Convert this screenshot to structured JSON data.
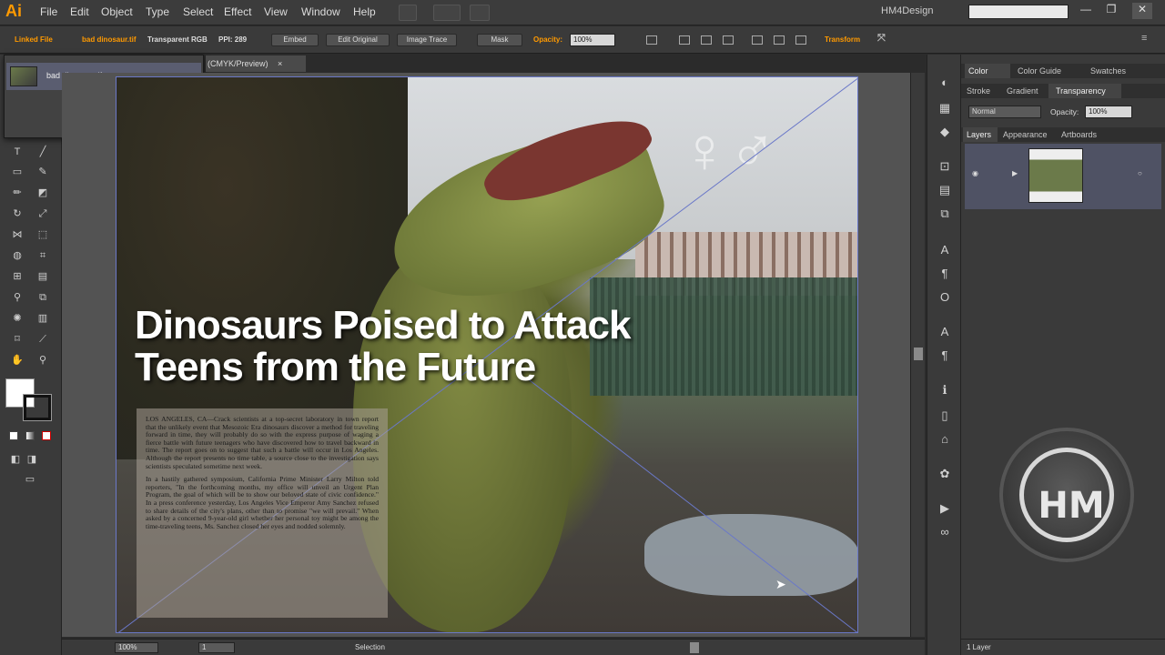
{
  "app": {
    "logo": "Ai",
    "workspace": "HM4Design",
    "search_placeholder": ""
  },
  "menu": [
    "File",
    "Edit",
    "Object",
    "Type",
    "Select",
    "Effect",
    "View",
    "Window",
    "Help"
  ],
  "controlbar": {
    "linked_file": "Linked File",
    "file_name": "bad dinosaur.tif",
    "color_mode": "Transparent RGB",
    "ppi": "PPI: 289",
    "embed": "Embed",
    "edit_original": "Edit Original",
    "image_trace": "Image Trace",
    "mask": "Mask",
    "opacity_label": "Opacity:",
    "opacity_value": "100%",
    "transform": "Transform"
  },
  "links_panel": {
    "item": "bad dinosaur.tif"
  },
  "document": {
    "tab_label": "(CMYK/Preview)"
  },
  "artboard": {
    "headline_line1": "Dinosaurs Poised to Attack",
    "headline_line2": "Teens from the Future",
    "paragraph1": "LOS ANGELES, CA—Crack scientists at a top-secret laboratory in town report that the unlikely event that Mesozoic Era dinosaurs discover a method for traveling forward in time, they will probably do so with the express purpose of waging a fierce battle with future teenagers who have discovered how to travel backward in time. The report goes on to suggest that such a battle will occur in Los Angeles. Although the report presents no time table, a source close to the investigation says scientists speculated sometime next week.",
    "paragraph2": "In a hastily gathered symposium, California Prime Minister Larry Milton told reporters, \"In the forthcoming months, my office will unveil an Urgent Plan Program, the goal of which will be to show our beloved state of civic confidence.\" In a press conference yesterday, Los Angeles Vice Emperor Amy Sanchez refused to share details of the city's plans, other than to promise \"we will prevail.\" When asked by a concerned 9-year-old girl whether her personal toy might be among the time-traveling teens, Ms. Sanchez closed her eyes and nodded solemnly."
  },
  "statusbar": {
    "zoom": "100%",
    "artboard_num": "1",
    "tool": "Selection"
  },
  "right_panels": {
    "tabs_row1": [
      "Color",
      "Color Guide",
      "Swatches"
    ],
    "tabs_row2": [
      "Stroke",
      "Gradient",
      "Transparency"
    ],
    "blend_mode": "Normal",
    "opacity_label": "Opacity:",
    "opacity_value": "100%",
    "tabs_row3": [
      "Layers",
      "Appearance",
      "Artboards"
    ],
    "layers_count": "1 Layer"
  },
  "watermark": {
    "text": "HM"
  },
  "colors": {
    "accent": "#ff9a00",
    "selection": "#6a78c8"
  }
}
